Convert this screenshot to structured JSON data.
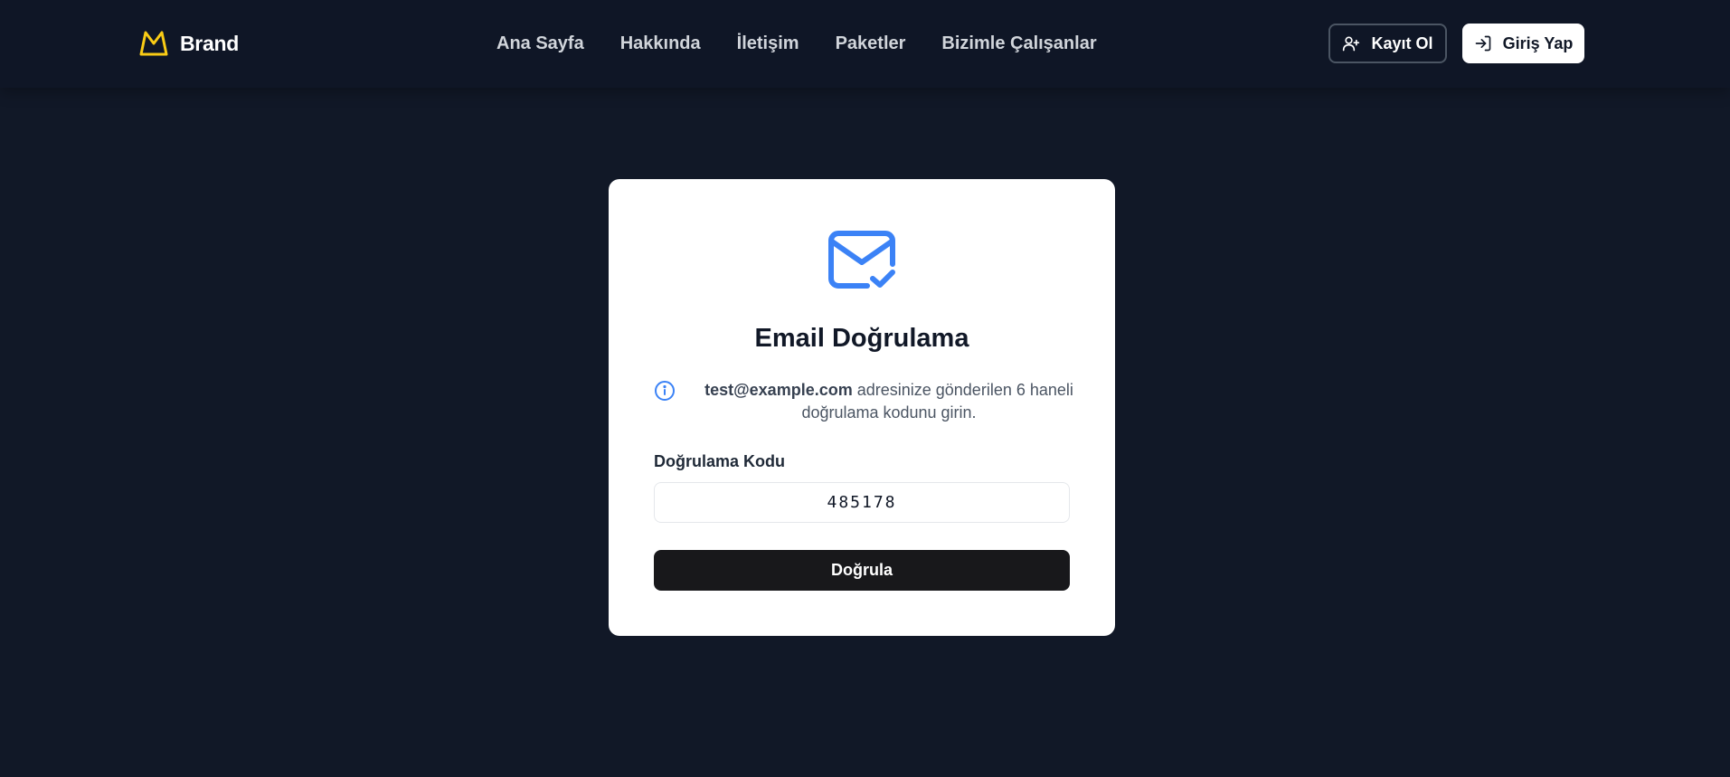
{
  "header": {
    "brand_name": "Brand",
    "brand_color": "#facc15",
    "nav": [
      {
        "label": "Ana Sayfa"
      },
      {
        "label": "Hakkında"
      },
      {
        "label": "İletişim"
      },
      {
        "label": "Paketler"
      },
      {
        "label": "Bizimle Çalışanlar"
      }
    ],
    "register_label": "Kayıt Ol",
    "login_label": "Giriş Yap"
  },
  "card": {
    "icon": "mail-check-icon",
    "accent_color": "#3b82f6",
    "title": "Email Doğrulama",
    "info_email": "test@example.com",
    "info_text": " adresinize gönderilen 6 haneli doğrulama kodunu girin.",
    "code_label": "Doğrulama Kodu",
    "code_value": "485178",
    "submit_label": "Doğrula"
  },
  "colors": {
    "background": "#111827",
    "navbar": "#0f1626",
    "button_dark": "#18181b"
  }
}
